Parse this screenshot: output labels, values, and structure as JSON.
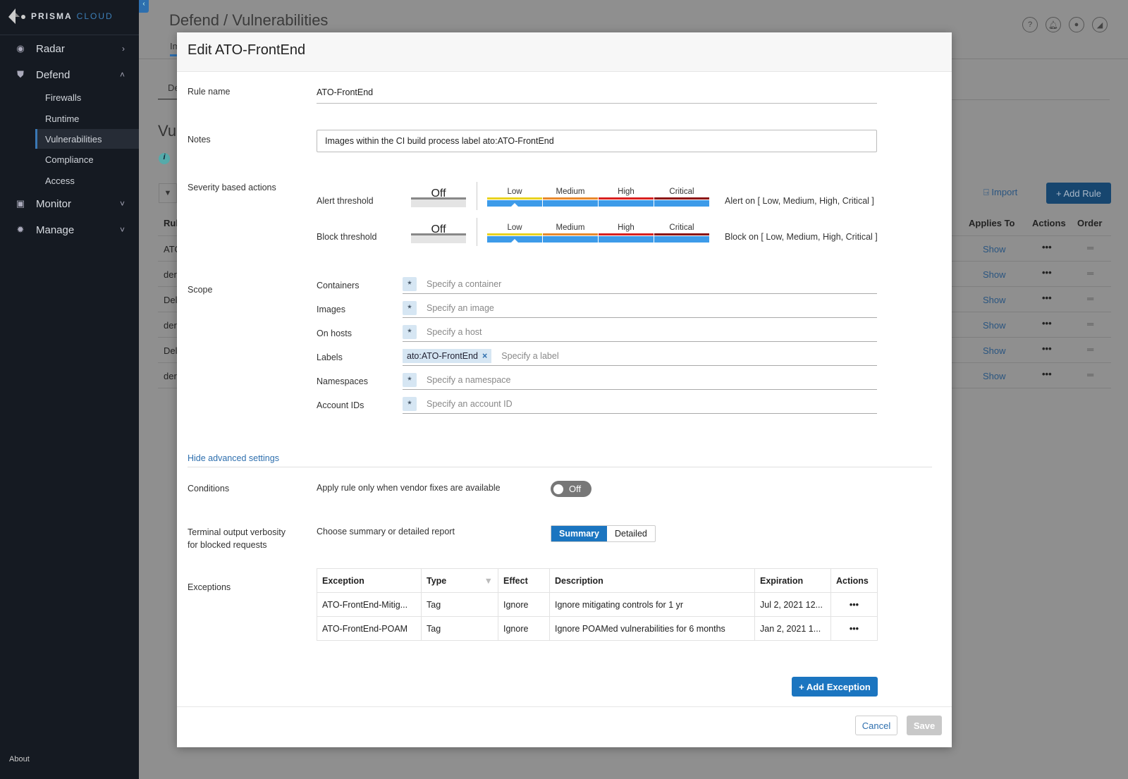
{
  "brand": {
    "name": "PRISMA",
    "sub": "CLOUD"
  },
  "sidebar": {
    "items": [
      {
        "label": "Radar",
        "icon": "radar-icon",
        "chevron": "›"
      },
      {
        "label": "Defend",
        "icon": "shield-icon",
        "chevron": "˄"
      },
      {
        "label": "Monitor",
        "icon": "monitor-icon",
        "chevron": "˅"
      },
      {
        "label": "Manage",
        "icon": "gear-icon",
        "chevron": "˅"
      }
    ],
    "defend_sub": [
      "Firewalls",
      "Runtime",
      "Vulnerabilities",
      "Compliance",
      "Access"
    ],
    "active": "Vulnerabilities",
    "about": "About"
  },
  "background": {
    "title": "Defend / Vulnerabilities",
    "tab1": "Im",
    "tab2": "De",
    "section": "Vu",
    "import": "Import",
    "add_rule": "+ Add Rule",
    "columns": [
      "Rul",
      "Applies To",
      "Actions",
      "Order"
    ],
    "rows": [
      {
        "name": "ATO",
        "applies": "Show"
      },
      {
        "name": "der",
        "applies": "Show"
      },
      {
        "name": "Del",
        "applies": "Show"
      },
      {
        "name": "der",
        "applies": "Show"
      },
      {
        "name": "Del",
        "applies": "Show"
      },
      {
        "name": "der",
        "applies": "Show"
      }
    ]
  },
  "modal": {
    "title": "Edit ATO-FrontEnd",
    "rule_name": {
      "label": "Rule name",
      "value": "ATO-FrontEnd"
    },
    "notes": {
      "label": "Notes",
      "value": "Images within the CI build process label ato:ATO-FrontEnd"
    },
    "severity": {
      "label": "Severity based actions",
      "off": "Off",
      "levels": [
        "Low",
        "Medium",
        "High",
        "Critical"
      ],
      "level_colors": [
        "#e8d21f",
        "#e8892c",
        "#d9201f",
        "#8b0d0d"
      ],
      "selected_color": "#3d9be9",
      "alert": {
        "label": "Alert threshold",
        "selected": "Low",
        "summary": "Alert on [ Low, Medium, High, Critical ]"
      },
      "block": {
        "label": "Block threshold",
        "selected": "Low",
        "summary": "Block on [ Low, Medium, High, Critical ]"
      }
    },
    "scope": {
      "label": "Scope",
      "fields": [
        {
          "label": "Containers",
          "placeholder": "Specify a container"
        },
        {
          "label": "Images",
          "placeholder": "Specify an image"
        },
        {
          "label": "On hosts",
          "placeholder": "Specify a host"
        },
        {
          "label": "Labels",
          "chip": "ato:ATO-FrontEnd",
          "placeholder": "Specify a label"
        },
        {
          "label": "Namespaces",
          "placeholder": "Specify a namespace"
        },
        {
          "label": "Account IDs",
          "placeholder": "Specify an account ID"
        }
      ]
    },
    "advanced_link": "Hide advanced settings",
    "conditions": {
      "label": "Conditions",
      "desc": "Apply rule only when vendor fixes are available",
      "toggle": "Off"
    },
    "verbosity": {
      "label1": "Terminal output verbosity",
      "label2": "for blocked requests",
      "desc": "Choose summary or detailed report",
      "options": [
        "Summary",
        "Detailed"
      ],
      "selected": "Summary"
    },
    "exceptions": {
      "label": "Exceptions",
      "columns": [
        "Exception",
        "Type",
        "Effect",
        "Description",
        "Expiration",
        "Actions"
      ],
      "rows": [
        [
          "ATO-FrontEnd-Mitig...",
          "Tag",
          "Ignore",
          "Ignore mitigating controls for 1 yr",
          "Jul 2, 2021 12..."
        ],
        [
          "ATO-FrontEnd-POAM",
          "Tag",
          "Ignore",
          "Ignore POAMed vulnerabilities for 6 months",
          "Jan 2, 2021 1..."
        ]
      ],
      "add": "+ Add Exception"
    },
    "cancel": "Cancel",
    "save": "Save"
  }
}
